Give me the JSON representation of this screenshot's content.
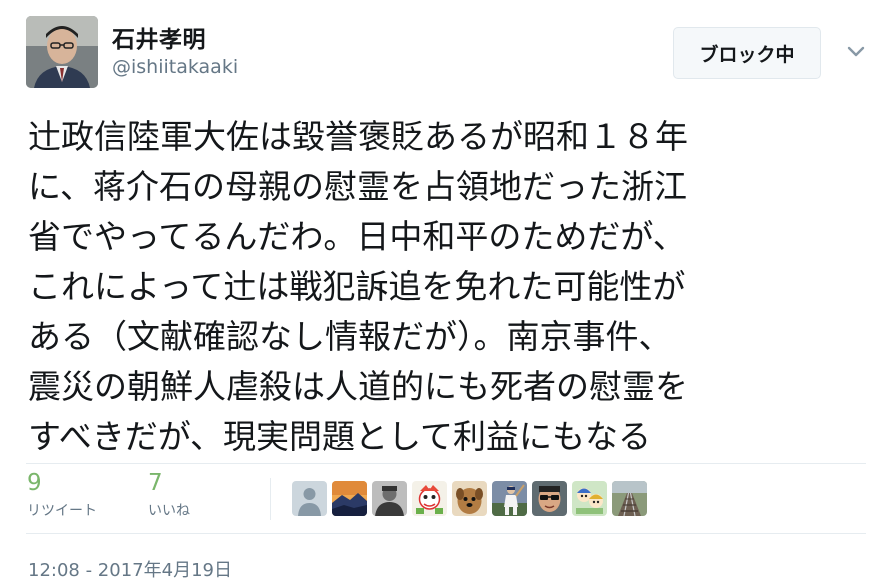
{
  "author": {
    "display_name": "石井孝明",
    "handle": "@ishiitakaaki",
    "avatar": "author-photo"
  },
  "actions": {
    "block_label": "ブロック中",
    "menu_icon": "chevron-down-icon"
  },
  "tweet": {
    "lines": [
      "辻政信陸軍大佐は毀誉褒貶あるが昭和１８年",
      "に、蒋介石の母親の慰霊を占領地だった浙江",
      "省でやってるんだわ。日中和平のためだが、",
      "これによって辻は戦犯訴追を免れた可能性が",
      "ある（文献確認なし情報だが）。南京事件、",
      "震災の朝鮮人虐殺は人道的にも死者の慰霊を",
      "すべきだが、現実問題として利益にもなる"
    ]
  },
  "stats": {
    "retweets": {
      "count": "9",
      "label": "リツイート"
    },
    "likes": {
      "count": "7",
      "label": "いいね"
    }
  },
  "likers": [
    {
      "icon": "default-avatar-icon"
    },
    {
      "icon": "mountain-landscape-avatar"
    },
    {
      "icon": "portrait-avatar"
    },
    {
      "icon": "character-avatar"
    },
    {
      "icon": "dog-avatar"
    },
    {
      "icon": "baseball-avatar"
    },
    {
      "icon": "sunglasses-avatar"
    },
    {
      "icon": "cartoon-avatar"
    },
    {
      "icon": "railway-avatar"
    }
  ],
  "timestamp": "12:08 - 2017年4月19日",
  "colors": {
    "accent_green": "#7ab66b",
    "text_primary": "#14171a",
    "text_secondary": "#657786",
    "border": "#e6ecf0",
    "button_bg": "#f5f8fa"
  }
}
